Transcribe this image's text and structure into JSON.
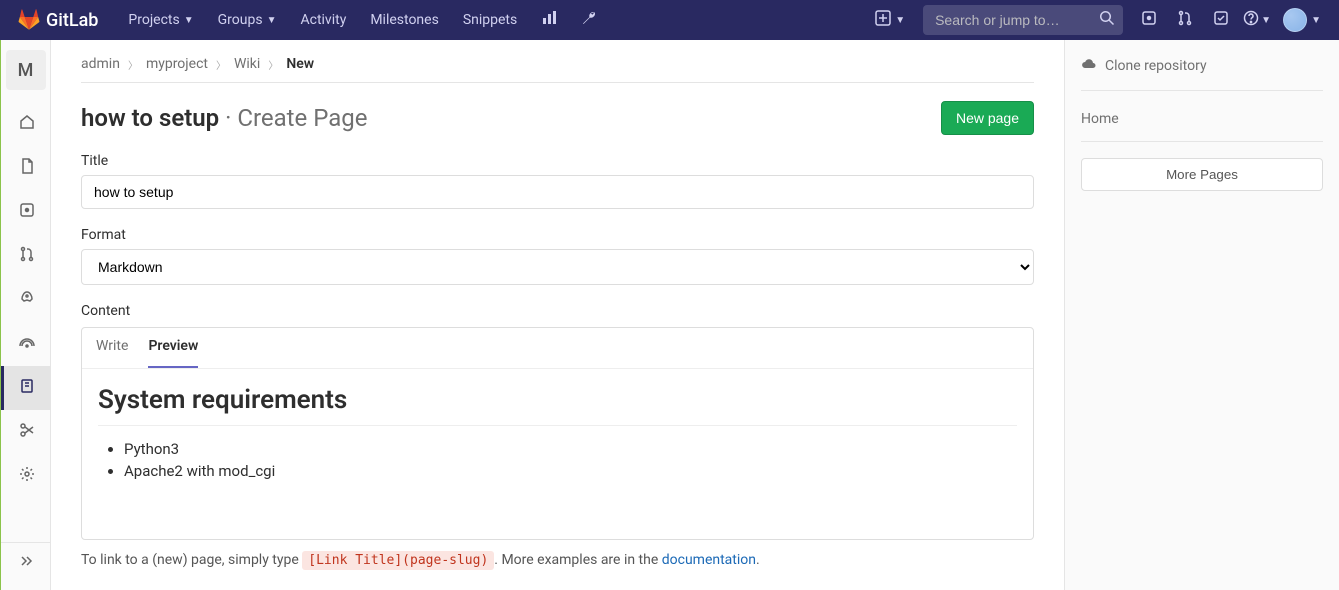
{
  "navbar": {
    "brand": "GitLab",
    "links": {
      "projects": "Projects",
      "groups": "Groups",
      "activity": "Activity",
      "milestones": "Milestones",
      "snippets": "Snippets"
    },
    "search_placeholder": "Search or jump to…"
  },
  "sidebar": {
    "project_letter": "M"
  },
  "breadcrumb": {
    "admin": "admin",
    "project": "myproject",
    "wiki": "Wiki",
    "current": "New"
  },
  "page": {
    "title": "how to setup",
    "suffix": " · Create Page",
    "new_page_btn": "New page"
  },
  "form": {
    "title_label": "Title",
    "title_value": "how to setup",
    "format_label": "Format",
    "format_value": "Markdown",
    "content_label": "Content",
    "tabs": {
      "write": "Write",
      "preview": "Preview"
    }
  },
  "preview": {
    "heading": "System requirements",
    "items": [
      "Python3",
      "Apache2 with mod_cgi"
    ]
  },
  "help": {
    "prefix": "To link to a (new) page, simply type ",
    "code": "[Link Title](page-slug)",
    "middle": ". More examples are in the ",
    "link": "documentation",
    "suffix": "."
  },
  "right": {
    "clone": "Clone repository",
    "home": "Home",
    "more": "More Pages"
  }
}
